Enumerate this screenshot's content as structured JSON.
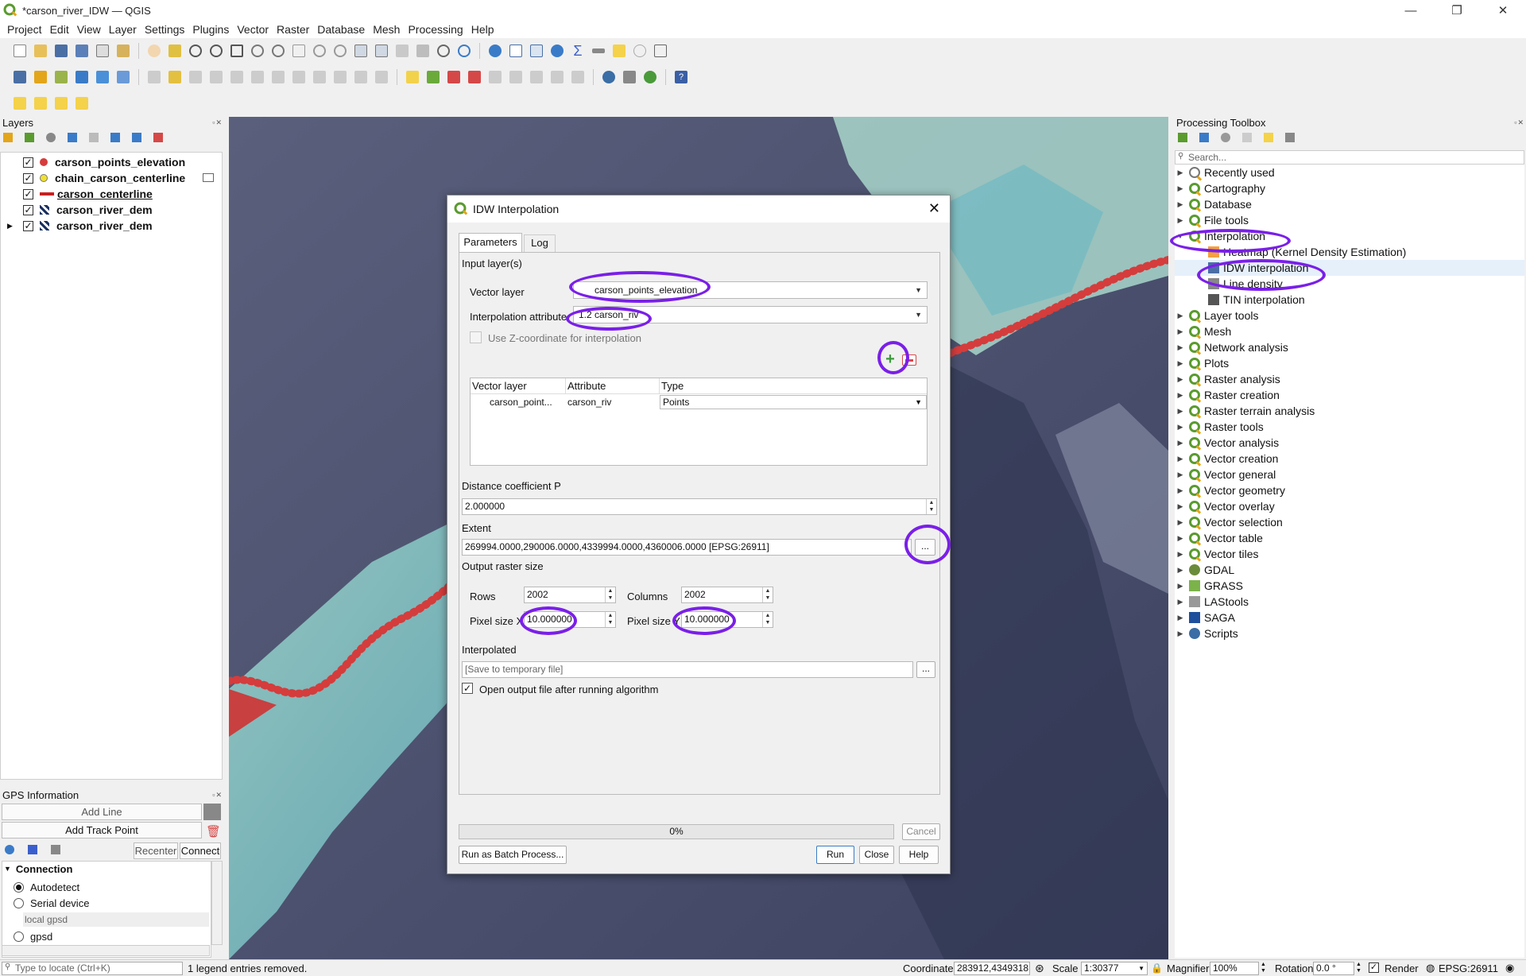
{
  "window": {
    "title": "*carson_river_IDW — QGIS",
    "controls": {
      "minimize": "—",
      "restore": "❐",
      "close": "✕"
    }
  },
  "menubar": [
    "Project",
    "Edit",
    "View",
    "Layer",
    "Settings",
    "Plugins",
    "Vector",
    "Raster",
    "Database",
    "Mesh",
    "Processing",
    "Help"
  ],
  "layers_panel": {
    "title": "Layers",
    "items": [
      {
        "name": "carson_points_elevation",
        "symbol": "red-dot",
        "checked": true
      },
      {
        "name": "chain_carson_centerline",
        "symbol": "yellow-dot",
        "checked": true
      },
      {
        "name": "carson_centerline",
        "symbol": "red-line",
        "checked": true
      },
      {
        "name": "carson_river_dem",
        "symbol": "raster",
        "checked": true
      },
      {
        "name": "carson_river_dem",
        "symbol": "raster",
        "checked": true
      }
    ],
    "check_mark": "✓"
  },
  "gps_panel": {
    "title": "GPS Information",
    "add_line": "Add Line",
    "add_track_point": "Add Track Point",
    "recenter": "Recenter",
    "connect": "Connect",
    "connection_header": "Connection",
    "options": [
      "Autodetect",
      "Serial device"
    ],
    "local_gpsd": "local gpsd",
    "gpsd": "gpsd"
  },
  "toolbox": {
    "title": "Processing Toolbox",
    "search_placeholder": "Search...",
    "groups_top": [
      "Recently used",
      "Cartography",
      "Database",
      "File tools"
    ],
    "interpolation": "Interpolation",
    "interpolation_children": [
      "Heatmap (Kernel Density Estimation)",
      "IDW interpolation",
      "Line density",
      "TIN interpolation"
    ],
    "groups_rest": [
      "Layer tools",
      "Mesh",
      "Network analysis",
      "Plots",
      "Raster analysis",
      "Raster creation",
      "Raster terrain analysis",
      "Raster tools",
      "Vector analysis",
      "Vector creation",
      "Vector general",
      "Vector geometry",
      "Vector overlay",
      "Vector selection",
      "Vector table",
      "Vector tiles"
    ],
    "providers": [
      "GDAL",
      "GRASS",
      "LAStools",
      "SAGA",
      "Scripts"
    ]
  },
  "dialog": {
    "title": "IDW Interpolation",
    "tabs": [
      "Parameters",
      "Log"
    ],
    "input_layers_label": "Input layer(s)",
    "vector_layer_label": "Vector layer",
    "vector_layer_value": "carson_points_elevation",
    "interp_attr_label": "Interpolation attribute",
    "interp_attr_value": "1.2 carson_riv",
    "use_z_label": "Use Z-coordinate for interpolation",
    "table_headers": [
      "Vector layer",
      "Attribute",
      "Type"
    ],
    "table_row": {
      "layer": "carson_point...",
      "attribute": "carson_riv",
      "type": "Points"
    },
    "distance_label": "Distance coefficient P",
    "distance_value": "2.000000",
    "extent_label": "Extent",
    "extent_value": "269994.0000,290006.0000,4339994.0000,4360006.0000 [EPSG:26911]",
    "output_size_label": "Output raster size",
    "rows_label": "Rows",
    "rows_value": "2002",
    "columns_label": "Columns",
    "columns_value": "2002",
    "pixel_size_label": "Pixel size X",
    "pixel_size_x": "10.000000",
    "pixel_size_y_label": "Pixel size Y",
    "pixel_size_y": "10.000000",
    "interpolated_label": "Interpolated",
    "interpolated_placeholder": "[Save to temporary file]",
    "open_output_label": "Open output file after running algorithm",
    "progress": 0,
    "progress_text": "0%",
    "cancel": "Cancel",
    "batch": "Run as Batch Process...",
    "run": "Run",
    "close": "Close",
    "help": "Help",
    "browse": "..."
  },
  "statusbar": {
    "locate_placeholder": "Type to locate (Ctrl+K)",
    "message": "1 legend entries removed.",
    "coordinate_label": "Coordinate",
    "coordinate_value": "283912,4349318",
    "scale_label": "Scale",
    "scale_value": "1:30377",
    "magnifier_label": "Magnifier",
    "magnifier_value": "100%",
    "rotation_label": "Rotation",
    "rotation_value": "0.0 °",
    "render_label": "Render",
    "crs": "EPSG:26911"
  },
  "colors": {
    "annotation": "#7a1fe8",
    "river_points": "#d53c3c",
    "qgis_green": "#5a9b2e"
  }
}
